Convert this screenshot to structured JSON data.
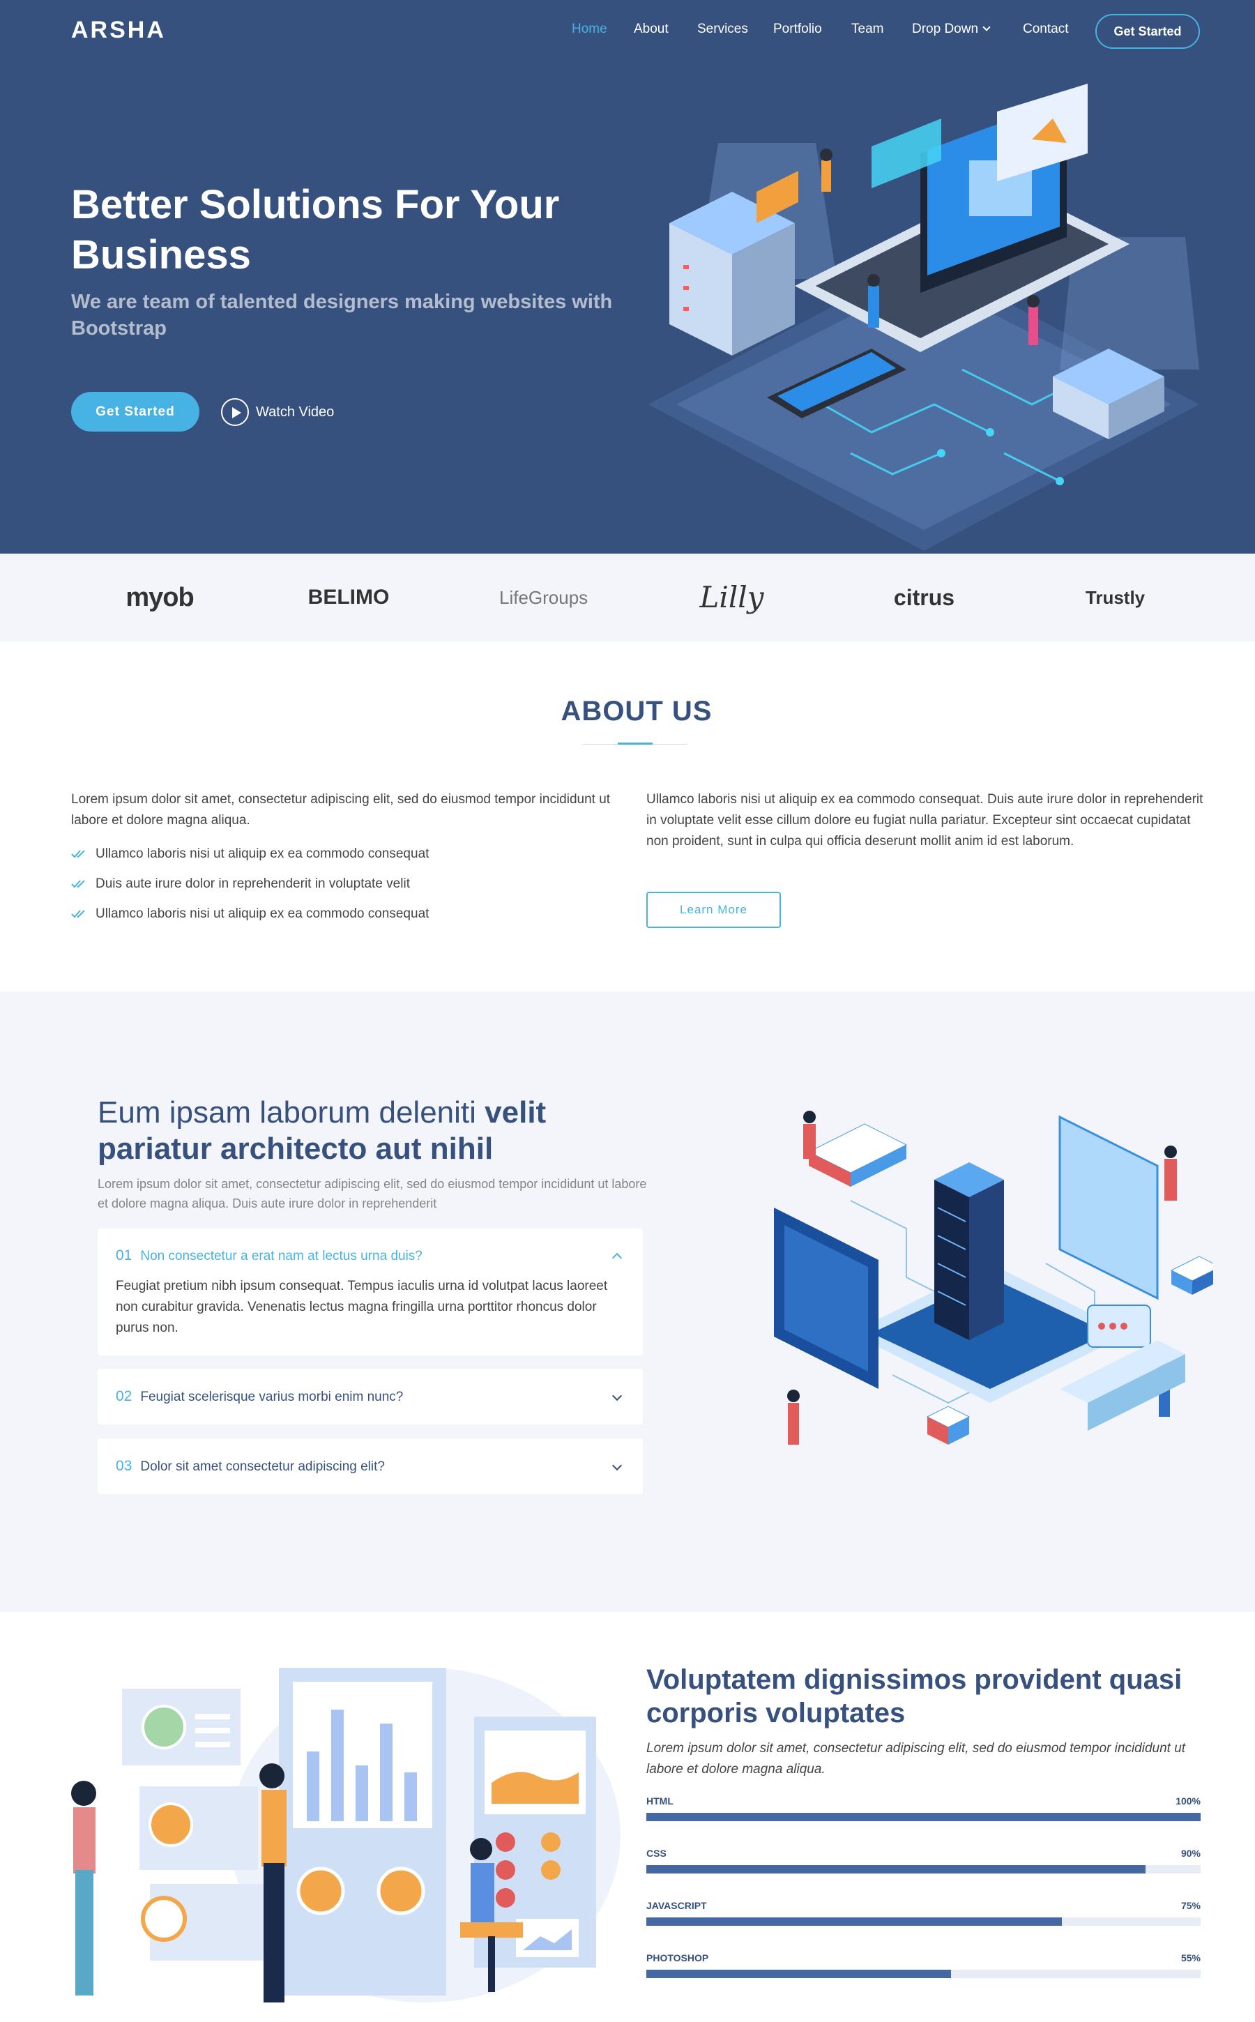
{
  "header": {
    "logo": "ARSHA",
    "nav": [
      "Home",
      "About",
      "Services",
      "Portfolio",
      "Team",
      "Drop Down",
      "Contact"
    ],
    "active": "Home",
    "cta": "Get Started"
  },
  "hero": {
    "title": "Better Solutions For Your Business",
    "subtitle": "We are team of talented designers making websites with Bootstrap",
    "primary_button": "Get Started",
    "video_link": "Watch Video"
  },
  "clients": [
    "myob",
    "BELIMO",
    "LifeGroups",
    "Lilly",
    "citrus",
    "Trustly"
  ],
  "about": {
    "title": "ABOUT US",
    "intro": "Lorem ipsum dolor sit amet, consectetur adipiscing elit, sed do eiusmod tempor incididunt ut labore et dolore magna aliqua.",
    "checks": [
      "Ullamco laboris nisi ut aliquip ex ea commodo consequat",
      "Duis aute irure dolor in reprehenderit in voluptate velit",
      "Ullamco laboris nisi ut aliquip ex ea commodo consequat"
    ],
    "text": "Ullamco laboris nisi ut aliquip ex ea commodo consequat. Duis aute irure dolor in reprehenderit in voluptate velit esse cillum dolore eu fugiat nulla pariatur. Excepteur sint occaecat cupidatat non proident, sunt in culpa qui officia deserunt mollit anim id est laborum.",
    "button": "Learn More"
  },
  "why": {
    "title_light": "Eum ipsam laborum deleniti",
    "title_bold": "velit pariatur architecto aut nihil",
    "text": "Lorem ipsum dolor sit amet, consectetur adipiscing elit, sed do eiusmod tempor incididunt ut labore et dolore magna aliqua. Duis aute irure dolor in reprehenderit",
    "faqs": [
      {
        "num": "01",
        "q": "Non consectetur a erat nam at lectus urna duis?",
        "a": "Feugiat pretium nibh ipsum consequat. Tempus iaculis urna id volutpat lacus laoreet non curabitur gravida. Venenatis lectus magna fringilla urna porttitor rhoncus dolor purus non.",
        "open": true
      },
      {
        "num": "02",
        "q": "Feugiat scelerisque varius morbi enim nunc?",
        "a": "",
        "open": false
      },
      {
        "num": "03",
        "q": "Dolor sit amet consectetur adipiscing elit?",
        "a": "",
        "open": false
      }
    ]
  },
  "skills": {
    "title": "Voluptatem dignissimos provident quasi corporis voluptates",
    "text": "Lorem ipsum dolor sit amet, consectetur adipiscing elit, sed do eiusmod tempor incididunt ut labore et dolore magna aliqua.",
    "items": [
      {
        "name": "HTML",
        "value": 100,
        "label": "100%"
      },
      {
        "name": "CSS",
        "value": 90,
        "label": "90%"
      },
      {
        "name": "JAVASCRIPT",
        "value": 75,
        "label": "75%"
      },
      {
        "name": "PHOTOSHOP",
        "value": 55,
        "label": "55%"
      }
    ]
  },
  "colors": {
    "hero_bg": "#37517e",
    "accent": "#47b2e4",
    "section_bg": "#f3f5fa",
    "skill_fill": "#4668a2"
  }
}
